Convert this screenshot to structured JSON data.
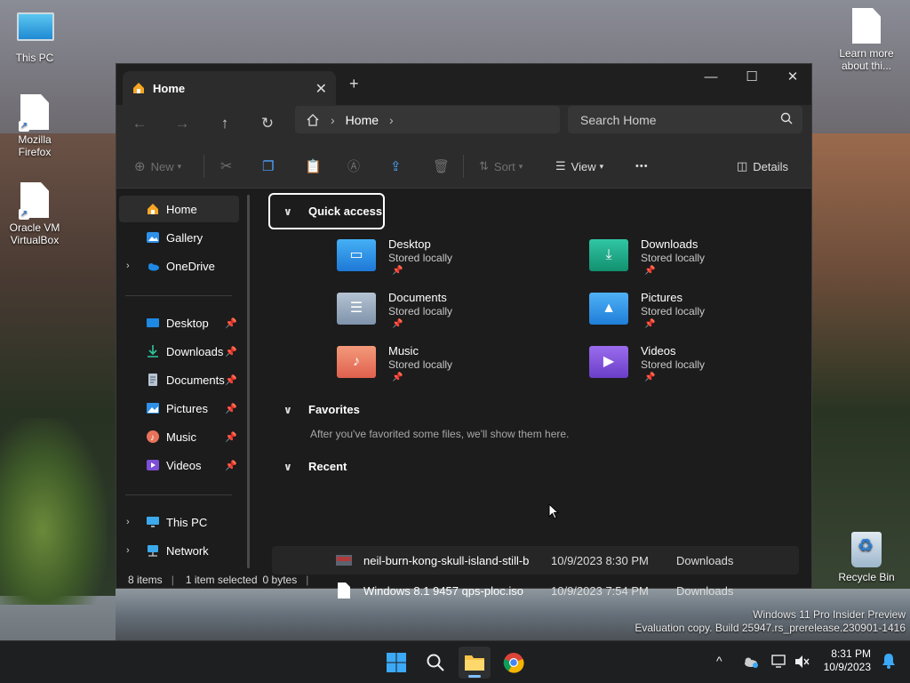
{
  "desktop": {
    "icons": [
      {
        "label": "This PC"
      },
      {
        "label": "Mozilla\nFirefox"
      },
      {
        "label": "Oracle VM\nVirtualBox"
      },
      {
        "label": "Learn more\nabout thi..."
      },
      {
        "label": "Recycle Bin"
      }
    ],
    "watermark": {
      "line1": "Windows 11 Pro Insider Preview",
      "line2": "Evaluation copy. Build 25947.rs_prerelease.230901-1416"
    }
  },
  "window": {
    "tab": {
      "label": "Home",
      "close_glyph": "✕"
    },
    "new_tab_glyph": "+",
    "controls": {
      "minimize": "—",
      "maximize": "☐",
      "close": "✕"
    },
    "nav": {
      "back": "←",
      "forward": "→",
      "up": "↑",
      "refresh": "↻"
    },
    "address": {
      "crumb": "Home",
      "sep": "›"
    },
    "search": {
      "placeholder": "Search Home"
    },
    "toolbar": {
      "new_label": "New",
      "sort_label": "Sort",
      "view_label": "View",
      "more_glyph": "•••",
      "details_label": "Details"
    },
    "sidebar": {
      "top": [
        {
          "label": "Home"
        },
        {
          "label": "Gallery"
        },
        {
          "label": "OneDrive"
        }
      ],
      "pinned": [
        {
          "label": "Desktop"
        },
        {
          "label": "Downloads"
        },
        {
          "label": "Documents"
        },
        {
          "label": "Pictures"
        },
        {
          "label": "Music"
        },
        {
          "label": "Videos"
        }
      ],
      "bottom": [
        {
          "label": "This PC"
        },
        {
          "label": "Network"
        }
      ],
      "pin_glyph": "📌",
      "expand_glyph": "›"
    },
    "content": {
      "quick_access": {
        "title": "Quick access",
        "items": [
          {
            "name": "Desktop",
            "sub": "Stored locally",
            "color": "#1e88e5"
          },
          {
            "name": "Downloads",
            "sub": "Stored locally",
            "color": "#16a58a"
          },
          {
            "name": "Documents",
            "sub": "Stored locally",
            "color": "#8da1b9"
          },
          {
            "name": "Pictures",
            "sub": "Stored locally",
            "color": "#2a8fe0"
          },
          {
            "name": "Music",
            "sub": "Stored locally",
            "color": "#e8735a"
          },
          {
            "name": "Videos",
            "sub": "Stored locally",
            "color": "#7b4fd6"
          }
        ]
      },
      "favorites": {
        "title": "Favorites",
        "note": "After you've favorited some files, we'll show them here."
      },
      "recent": {
        "title": "Recent",
        "items": [
          {
            "name": "neil-burn-kong-skull-island-still-b",
            "date": "10/9/2023 8:30 PM",
            "location": "Downloads"
          },
          {
            "name": "Windows 8.1 9457 qps-ploc.iso",
            "date": "10/9/2023 7:54 PM",
            "location": "Downloads"
          }
        ]
      }
    },
    "status": {
      "items": "8 items",
      "selected": "1 item selected",
      "size": "0 bytes",
      "sep": "|"
    }
  },
  "taskbar": {
    "clock": {
      "time": "8:31 PM",
      "date": "10/9/2023"
    },
    "tray_chevron": "^"
  }
}
